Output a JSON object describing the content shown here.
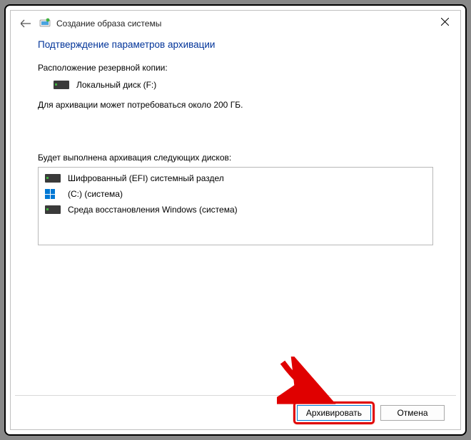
{
  "titlebar": {
    "title": "Создание образа системы"
  },
  "content": {
    "heading": "Подтверждение параметров архивации",
    "location_label": "Расположение резервной копии:",
    "location_value": "Локальный диск (F:)",
    "space_required": "Для архивации может потребоваться около 200 ГБ.",
    "drives_label": "Будет выполнена архивация следующих дисков:",
    "drives": [
      {
        "name": "Шифрованный (EFI) системный раздел",
        "icon": "disk"
      },
      {
        "name": "(C:) (система)",
        "icon": "windows"
      },
      {
        "name": "Среда восстановления Windows (система)",
        "icon": "disk"
      }
    ]
  },
  "footer": {
    "primary": "Архивировать",
    "cancel": "Отмена"
  }
}
